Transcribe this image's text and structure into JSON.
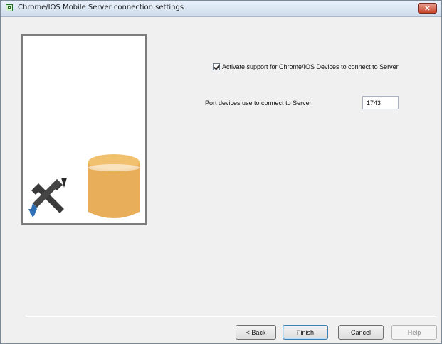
{
  "window": {
    "title": "Chrome/IOS Mobile Server connection settings"
  },
  "titlebar": {
    "close_glyph": "✕"
  },
  "illustration": {
    "icons": [
      "tools-icon",
      "database-icon"
    ],
    "db_color": "#E8AE5A",
    "tool_handle_color": "#2E6FB5"
  },
  "settings": {
    "activate_label": "Activate support for Chrome/IOS Devices to connect to Server",
    "activate_checked": true,
    "port_label": "Port devices use to connect to Server",
    "port_value": "1743"
  },
  "buttons": {
    "back": "< Back",
    "finish": "Finish",
    "cancel": "Cancel",
    "help": "Help"
  }
}
